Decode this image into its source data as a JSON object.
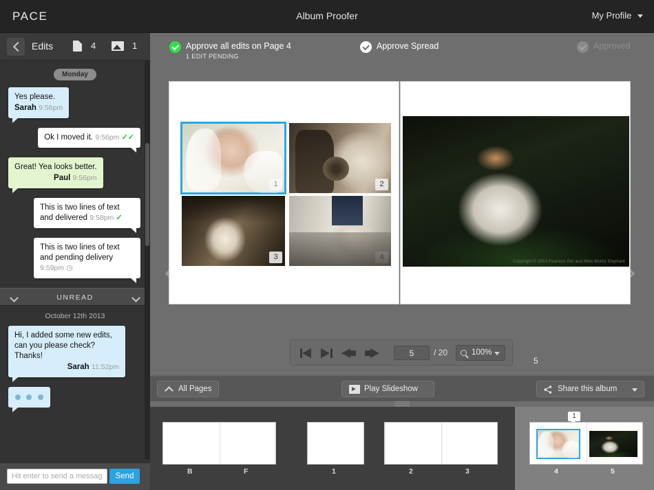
{
  "topbar": {
    "brand": "PACE",
    "title": "Album Proofer",
    "profile": "My Profile"
  },
  "sidebar": {
    "header": {
      "back_icon": "chevron-left-icon",
      "title": "Edits",
      "doc_icon": "document-icon",
      "doc_count": "4",
      "image_icon": "image-icon",
      "image_count": "1"
    },
    "day_pill": "Monday",
    "messages": [
      {
        "side": "left",
        "color": "blue",
        "text": "Yes please.",
        "author": "Sarah",
        "time": "9:56pm",
        "status": ""
      },
      {
        "side": "right",
        "color": "white",
        "text": "Ok I moved it.",
        "author": "",
        "time": "9:56pm",
        "status": "read"
      },
      {
        "side": "left",
        "color": "green",
        "text": "Great! Yea looks better.",
        "author": "Paul",
        "time": "9:56pm",
        "status": ""
      },
      {
        "side": "right",
        "color": "white",
        "text": "This is two lines of text and delivered",
        "author": "",
        "time": "9:58pm",
        "status": "delivered"
      },
      {
        "side": "right",
        "color": "white",
        "text": "This is two lines of text and pending delivery",
        "author": "",
        "time": "9:59pm",
        "status": "pending"
      }
    ],
    "unread_divider": "UNREAD",
    "date_label": "October 12th 2013",
    "unread_message": {
      "text": "Hi, I added some new edits, can you please check? Thanks!",
      "author": "Sarah",
      "time": "11:52pm"
    },
    "typing_indicator": "typing-indicator",
    "composer": {
      "placeholder": "Hit enter to send a message",
      "value": "",
      "send_label": "Send"
    }
  },
  "approve_bar": {
    "approve_all": {
      "label": "Approve all edits on Page 4",
      "sub": "1 EDIT PENDING",
      "state": "pending",
      "color": "#2fe04a"
    },
    "approve_spread": {
      "label": "Approve Spread",
      "state": "available",
      "color": "#ffffff"
    },
    "approved": {
      "label": "Approved",
      "state": "disabled",
      "color": "#8e8e8e"
    }
  },
  "spread": {
    "prev_arrow": "chevron-left-icon",
    "next_arrow": "chevron-right-icon",
    "left_page": {
      "number": "4",
      "photos": [
        {
          "badge": "1",
          "selected": true,
          "alt": "bride-portrait-veil"
        },
        {
          "badge": "2",
          "selected": false,
          "alt": "sepia-couple-bouquet"
        },
        {
          "badge": "3",
          "selected": false,
          "alt": "sepia-confetti-exit"
        },
        {
          "badge": "4",
          "selected": false,
          "alt": "aisle-walk-ceremony"
        }
      ]
    },
    "right_page": {
      "number": "5",
      "photos": [
        {
          "badge": "",
          "selected": false,
          "alt": "forest-bride-seated",
          "copyright": "Copyright © 2013 Fearless Girl and Mike Mortis Elephant"
        }
      ]
    }
  },
  "pager": {
    "first_icon": "first-page-icon",
    "prev_icon": "prev-page-icon",
    "back_icon": "back-arrow-icon",
    "forward_icon": "forward-arrow-icon",
    "page_value": "5",
    "page_total": "/ 20",
    "zoom_icon": "magnifier-icon",
    "zoom_value": "100%"
  },
  "bottom_toolbar": {
    "all_pages": {
      "label": "All Pages",
      "icon": "chevron-up-icon"
    },
    "play_slideshow": {
      "label": "Play Slideshow",
      "icon": "film-icon"
    },
    "share_album": {
      "label": "Share this album",
      "icon": "share-icon"
    },
    "drag_handle": "resize-handle"
  },
  "filmstrip": {
    "spreads": [
      {
        "labels": [
          "B",
          "F"
        ],
        "pages": 2,
        "selected": false,
        "badge": ""
      },
      {
        "labels": [
          "1"
        ],
        "pages": 1,
        "selected": false,
        "badge": ""
      },
      {
        "labels": [
          "2",
          "3"
        ],
        "pages": 2,
        "selected": false,
        "badge": ""
      },
      {
        "labels": [
          "4",
          "5"
        ],
        "pages": 2,
        "selected": true,
        "badge": "1"
      }
    ]
  },
  "colors": {
    "accent_blue": "#27a9e3",
    "approve_green": "#2fe04a",
    "send_blue": "#2aa3e0",
    "sidebar_bg": "#333333",
    "main_bg": "#6e6e6e",
    "topbar_bg": "#242424"
  }
}
